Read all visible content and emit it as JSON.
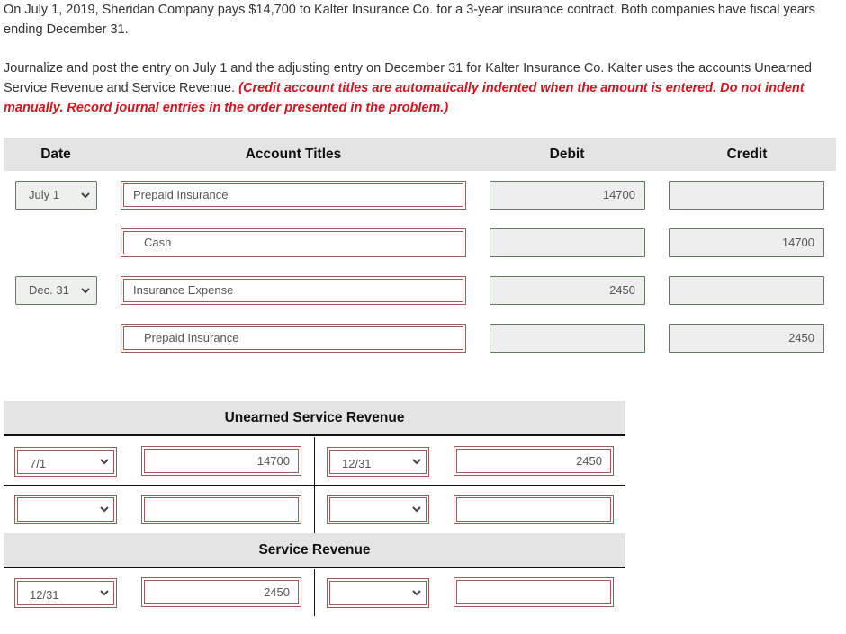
{
  "problem": {
    "intro": "On July 1, 2019, Sheridan Company pays $14,700 to Kalter Insurance Co. for a 3-year insurance contract. Both companies have fiscal years ending December 31.",
    "instructions": "Journalize and post the entry on July 1 and the adjusting entry on December 31 for Kalter Insurance Co. Kalter uses the accounts Unearned Service Revenue and Service Revenue. ",
    "instructions_note": "(Credit account titles are automatically indented when the amount is entered. Do not indent manually. Record journal entries in the order presented in the problem.)",
    "note_color": "#d5121e"
  },
  "journal": {
    "headers": {
      "date": "Date",
      "account_titles": "Account Titles",
      "debit": "Debit",
      "credit": "Credit"
    },
    "rows": [
      {
        "date": "July 1",
        "account": "Prepaid Insurance",
        "debit": "14700",
        "credit": ""
      },
      {
        "date": "",
        "account": "Cash",
        "debit": "",
        "credit": "14700"
      },
      {
        "date": "Dec. 31",
        "account": "Insurance Expense",
        "debit": "2450",
        "credit": ""
      },
      {
        "date": "",
        "account": "Prepaid Insurance",
        "debit": "",
        "credit": "2450"
      }
    ]
  },
  "t_accounts": [
    {
      "title": "Unearned Service Revenue",
      "rows": [
        {
          "left_date": "7/1",
          "left_amount": "14700",
          "right_date": "12/31",
          "right_amount": "2450"
        },
        {
          "left_date": "",
          "left_amount": "",
          "right_date": "",
          "right_amount": ""
        }
      ]
    },
    {
      "title": "Service Revenue",
      "rows": [
        {
          "left_date": "12/31",
          "left_amount": "2450",
          "right_date": "",
          "right_amount": ""
        }
      ]
    }
  ],
  "colors": {
    "header_bg": "#e4e4e4",
    "input_border_green": "#5f7a5f",
    "input_border_red": "#a05a5a"
  }
}
